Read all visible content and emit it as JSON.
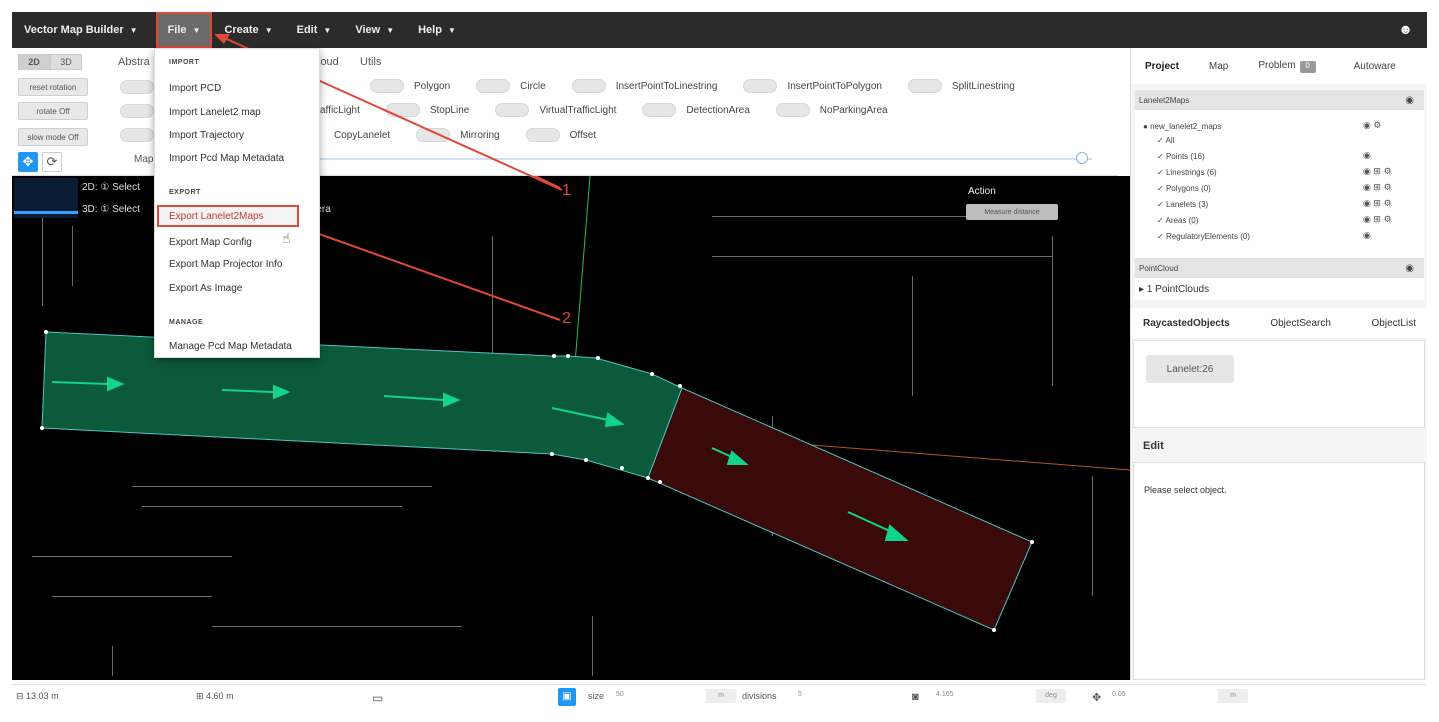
{
  "topbar": {
    "app_name": "Vector Map Builder",
    "menus": [
      "File",
      "Create",
      "Edit",
      "View",
      "Help"
    ]
  },
  "toolbar": {
    "mode_2d": "2D",
    "mode_3d": "3D",
    "reset_rotation": "reset rotation",
    "rotate": "rotate Off",
    "slow_mode": "slow mode Off",
    "tabs": [
      "Abstra",
      "loud",
      "Utils"
    ],
    "map_label": "Map o",
    "row1": [
      "Polygon",
      "Circle",
      "InsertPointToLinestring",
      "InsertPointToPolygon",
      "SplitLinestring"
    ],
    "row1_left": "",
    "row2_left": "afficLight",
    "row2": [
      "StopLine",
      "VirtualTrafficLight",
      "DetectionArea",
      "NoParkingArea"
    ],
    "row3": [
      "CopyLanelet",
      "Mirroring",
      "Offset"
    ]
  },
  "dropdown": {
    "import_header": "IMPORT",
    "import_items": [
      "Import PCD",
      "Import Lanelet2 map",
      "Import Trajectory",
      "Import Pcd Map Metadata"
    ],
    "export_header": "EXPORT",
    "export_items": [
      "Export Lanelet2Maps",
      "Export Map Config",
      "Export Map Projector Info",
      "Export As Image"
    ],
    "manage_header": "MANAGE",
    "manage_items": [
      "Manage Pcd Map Metadata"
    ]
  },
  "viewport": {
    "line_2d": "2D: ① Select",
    "line_3d": "3D: ① Select",
    "camera_suffix": "mera",
    "action_label": "Action",
    "action_button": "Measure distance",
    "annotation_1": "1",
    "annotation_2": "2"
  },
  "right_panel": {
    "tabs": [
      "Project",
      "Map",
      "Problem",
      "Autoware"
    ],
    "problem_count": "0",
    "lanelet_header": "Lanelet2Maps",
    "map_name": "new_lanelet2_maps",
    "tree": [
      "All",
      "Points (16)",
      "Linestrings (6)",
      "Polygons (0)",
      "Lanelets (3)",
      "Areas (0)",
      "RegulatoryElements (0)"
    ],
    "pointcloud_header": "PointCloud",
    "pointcloud_item": "1 PointClouds",
    "bottom_tabs": [
      "RaycastedObjects",
      "ObjectSearch",
      "ObjectList"
    ],
    "raycast_chip": "Lanelet:26",
    "edit_header": "Edit",
    "edit_placeholder": "Please select object."
  },
  "statusbar": {
    "width": "13.03 m",
    "height": "4.60 m",
    "size_label": "size",
    "size_value": "50",
    "m_unit": "m",
    "divisions_label": "divisions",
    "divisions_value": "5",
    "angle_value": "4.165",
    "deg_unit": "deg",
    "step_value": "0.05",
    "m_unit2": "m"
  }
}
